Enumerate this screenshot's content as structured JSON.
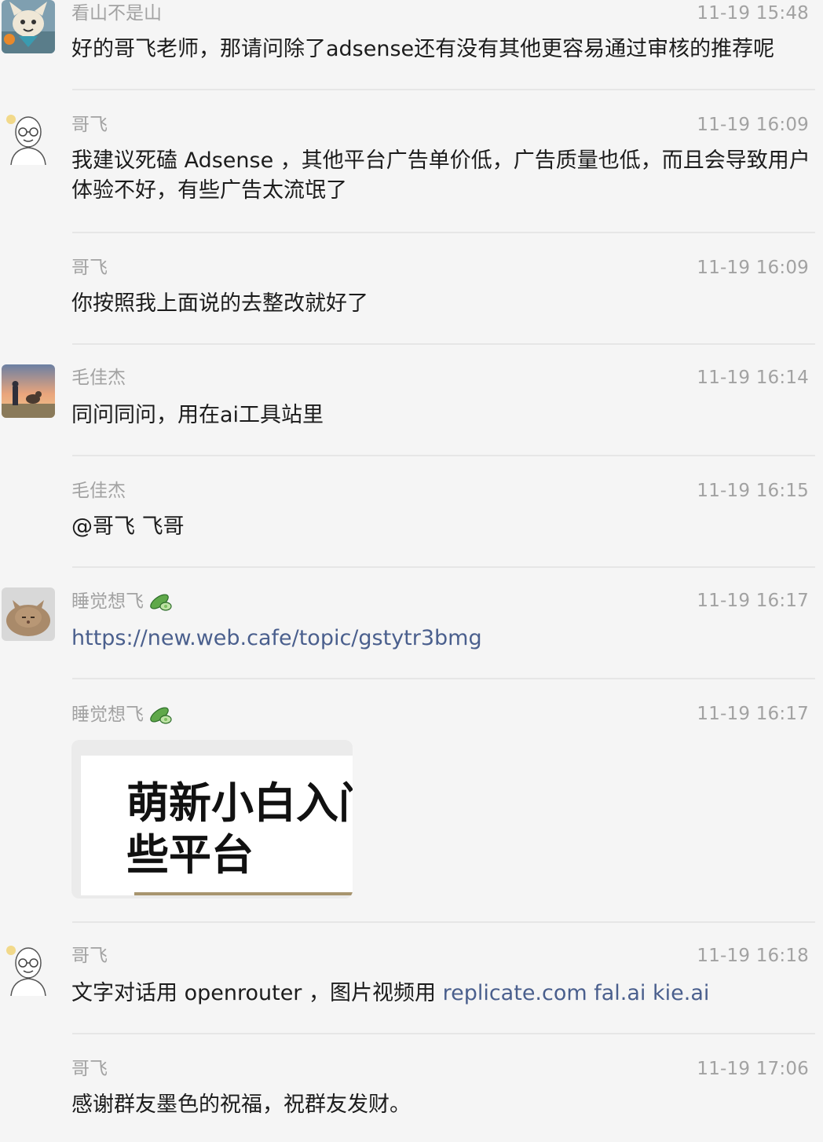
{
  "messages": [
    {
      "sender": "看山不是山",
      "time": "11-19 15:48",
      "text": "好的哥飞老师，那请问除了adsense还有没有其他更容易通过审核的推荐呢",
      "avatar": "cartoon-character-avatar"
    },
    {
      "sender": "哥飞",
      "time": "11-19 16:09",
      "text": "我建议死磕 Adsense ，其他平台广告单价低，广告质量也低，而且会导致用户体验不好，有些广告太流氓了",
      "avatar": "bald-man-glasses-avatar"
    },
    {
      "sender": "哥飞",
      "time": "11-19 16:09",
      "text": "你按照我上面说的去整改就好了"
    },
    {
      "sender": "毛佳杰",
      "time": "11-19 16:14",
      "text": "同问同问，用在ai工具站里",
      "avatar": "boy-and-dog-sunset-avatar"
    },
    {
      "sender": "毛佳杰",
      "time": "11-19 16:15",
      "text": "@哥飞 飞哥"
    },
    {
      "sender": "睡觉想飞",
      "time": "11-19 16:17",
      "link": "https://new.web.cafe/topic/gstytr3bmg",
      "avatar": "cat-avatar",
      "badge": "cucumber-emoji"
    },
    {
      "sender": "睡觉想飞",
      "time": "11-19 16:17",
      "image_text_line1": "萌新小白入门",
      "image_text_line2": "些平台",
      "badge": "cucumber-emoji"
    },
    {
      "sender": "哥飞",
      "time": "11-19 16:18",
      "text_prefix": "文字对话用 openrouter ，图片视频用 ",
      "links": "replicate.com fal.ai kie.ai",
      "avatar": "bald-man-glasses-avatar"
    },
    {
      "sender": "哥飞",
      "time": "11-19 17:06",
      "text": "感谢群友墨色的祝福，祝群友发财。"
    }
  ],
  "colors": {
    "background": "#f5f5f5",
    "meta_text": "#a2a2a2",
    "body_text": "#1c1c1c",
    "link": "#4a5f8d",
    "divider": "#e6e6e6"
  }
}
